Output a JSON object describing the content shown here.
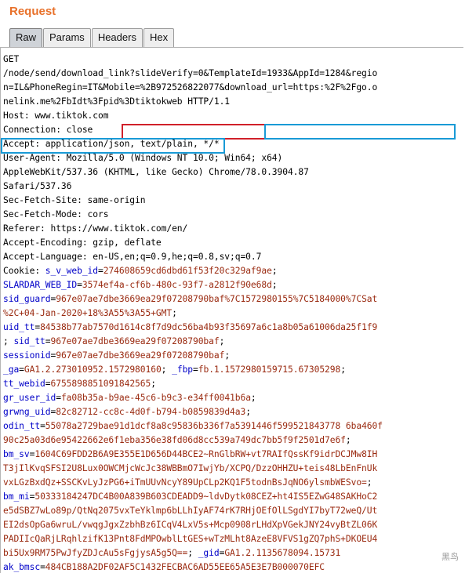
{
  "title": "Request",
  "tabs": [
    "Raw",
    "Params",
    "Headers",
    "Hex"
  ],
  "active_tab": "Raw",
  "lines": [
    [
      {
        "t": "GET",
        "c": "k"
      }
    ],
    [
      {
        "t": "/node/send/download_link?slideVerify=0&TemplateId=1933&AppId=1284&regio",
        "c": "k"
      }
    ],
    [
      {
        "t": "n=IL&PhoneRegin=IT&Mobile=%2B972526822077&download_url=https:%2F%2Fgo.o",
        "c": "k"
      }
    ],
    [
      {
        "t": "nelink.me%2FbIdt%3Fpid%3Dtiktokweb HTTP/1.1",
        "c": "k"
      }
    ],
    [
      {
        "t": "Host: www.tiktok.com",
        "c": "k"
      }
    ],
    [
      {
        "t": "Connection: close",
        "c": "k"
      }
    ],
    [
      {
        "t": "Accept: application/json, text/plain, */*",
        "c": "k"
      }
    ],
    [
      {
        "t": "User-Agent: Mozilla/5.0 (Windows NT 10.0; Win64; x64)",
        "c": "k"
      }
    ],
    [
      {
        "t": "AppleWebKit/537.36 (KHTML, like Gecko) Chrome/78.0.3904.87",
        "c": "k"
      }
    ],
    [
      {
        "t": "Safari/537.36",
        "c": "k"
      }
    ],
    [
      {
        "t": "Sec-Fetch-Site: same-origin",
        "c": "k"
      }
    ],
    [
      {
        "t": "Sec-Fetch-Mode: cors",
        "c": "k"
      }
    ],
    [
      {
        "t": "Referer: https://www.tiktok.com/en/",
        "c": "k"
      }
    ],
    [
      {
        "t": "Accept-Encoding: gzip, deflate",
        "c": "k"
      }
    ],
    [
      {
        "t": "Accept-Language: en-US,en;q=0.9,he;q=0.8,sv;q=0.7",
        "c": "k"
      }
    ],
    [
      {
        "t": "Cookie: ",
        "c": "k"
      },
      {
        "t": "s_v_web_id",
        "c": "u"
      },
      {
        "t": "=",
        "c": "k"
      },
      {
        "t": "274608659cd6dbd61f53f20c329af9ae",
        "c": "v"
      },
      {
        "t": ";",
        "c": "k"
      }
    ],
    [
      {
        "t": "SLARDAR_WEB_ID",
        "c": "u"
      },
      {
        "t": "=",
        "c": "k"
      },
      {
        "t": "3574ef4a-cf6b-480c-93f7-a2812f90e68d",
        "c": "v"
      },
      {
        "t": ";",
        "c": "k"
      }
    ],
    [
      {
        "t": "sid_guard",
        "c": "u"
      },
      {
        "t": "=",
        "c": "k"
      },
      {
        "t": "967e07ae7dbe3669ea29f07208790baf%7C1572980155%7C5184000%7CSat",
        "c": "v"
      }
    ],
    [
      {
        "t": "%2C+04-Jan-2020+18%3A55%3A55+GMT",
        "c": "v"
      },
      {
        "t": ";",
        "c": "k"
      }
    ],
    [
      {
        "t": "uid_tt",
        "c": "u"
      },
      {
        "t": "=",
        "c": "k"
      },
      {
        "t": "84538b77ab7570d1614c8f7d9dc56ba4b93f35697a6c1a8b05a61006da25f1f9",
        "c": "v"
      }
    ],
    [
      {
        "t": "; ",
        "c": "k"
      },
      {
        "t": "sid_tt",
        "c": "u"
      },
      {
        "t": "=",
        "c": "k"
      },
      {
        "t": "967e07ae7dbe3669ea29f07208790baf",
        "c": "v"
      },
      {
        "t": ";",
        "c": "k"
      }
    ],
    [
      {
        "t": "sessionid",
        "c": "u"
      },
      {
        "t": "=",
        "c": "k"
      },
      {
        "t": "967e07ae7dbe3669ea29f07208790baf",
        "c": "v"
      },
      {
        "t": ";",
        "c": "k"
      }
    ],
    [
      {
        "t": "_ga",
        "c": "u"
      },
      {
        "t": "=",
        "c": "k"
      },
      {
        "t": "GA1.2.273010952.1572980160",
        "c": "v"
      },
      {
        "t": "; ",
        "c": "k"
      },
      {
        "t": "_fbp",
        "c": "u"
      },
      {
        "t": "=",
        "c": "k"
      },
      {
        "t": "fb.1.1572980159715.67305298",
        "c": "v"
      },
      {
        "t": ";",
        "c": "k"
      }
    ],
    [
      {
        "t": "tt_webid",
        "c": "u"
      },
      {
        "t": "=",
        "c": "k"
      },
      {
        "t": "6755898851091842565",
        "c": "v"
      },
      {
        "t": ";",
        "c": "k"
      }
    ],
    [
      {
        "t": "gr_user_id",
        "c": "u"
      },
      {
        "t": "=",
        "c": "k"
      },
      {
        "t": "fa08b35a-b9ae-45c6-b9c3-e34ff0041b6a",
        "c": "v"
      },
      {
        "t": ";",
        "c": "k"
      }
    ],
    [
      {
        "t": "grwng_uid",
        "c": "u"
      },
      {
        "t": "=",
        "c": "k"
      },
      {
        "t": "82c82712-cc8c-4d0f-b794-b0859839d4a3",
        "c": "v"
      },
      {
        "t": ";",
        "c": "k"
      }
    ],
    [
      {
        "t": "odin_tt",
        "c": "u"
      },
      {
        "t": "=",
        "c": "k"
      },
      {
        "t": "55078a2729bae91d1dcf8a8c95836b336f7a5391446f599521843778 6ba460f",
        "c": "v"
      }
    ],
    [
      {
        "t": "90c25a03d6e95422662e6f1eba356e38fd06d8cc539a749dc7bb5f9f2501d7e6f",
        "c": "v"
      },
      {
        "t": ";",
        "c": "k"
      }
    ],
    [
      {
        "t": "bm_sv",
        "c": "u"
      },
      {
        "t": "=",
        "c": "k"
      },
      {
        "t": "1604C69FDD2B6A9E355E1D656D44BCE2~RnGlbRW+vt7RAIfQssKf9idrDCJMw8IH",
        "c": "v"
      }
    ],
    [
      {
        "t": "T3jIlKvqSFSI2U8Lux0OWCMjcWcJc38WBBmO7IwjYb/XCPQ/DzzOHHZU+teis48LbEnFnUk",
        "c": "v"
      }
    ],
    [
      {
        "t": "vxLGzBxdQz+SSCKvLyJzPG6+iTmUUvNcyY89UpCLp2KQ1F5todnBsJqNO6ylsmbWESvo=",
        "c": "v"
      },
      {
        "t": ";",
        "c": "k"
      }
    ],
    [
      {
        "t": "bm_mi",
        "c": "u"
      },
      {
        "t": "=",
        "c": "k"
      },
      {
        "t": "50333184247DC4B00A839B603CDEADD9~ldvDytk08CEZ+ht4IS5EZwG48SAKHoC2",
        "c": "v"
      }
    ],
    [
      {
        "t": "e5dSBZ7wLo89p/QtNq2075vxTeYklmp6bLLhIyAF74rK7RHjOEfOlLSgdYI7byT72weQ/Ut",
        "c": "v"
      }
    ],
    [
      {
        "t": "EI2dsOpGa6wruL/vwqgJgxZzbhBz6ICqV4LxV5s+Mcp0908rLHdXpVGekJNY24vyBtZL06K",
        "c": "v"
      }
    ],
    [
      {
        "t": "PADIIcQaRjLRqhlzifK13Pnt8FdMPOwblLtGES+wTzMLht8AzeE8VFVS1gZQ7phS+DKOEU4",
        "c": "v"
      }
    ],
    [
      {
        "t": "bi5Ux9RM75PwJfyZDJcAu5sFgjysA5g5Q==",
        "c": "v"
      },
      {
        "t": "; ",
        "c": "k"
      },
      {
        "t": "_gid",
        "c": "u"
      },
      {
        "t": "=",
        "c": "k"
      },
      {
        "t": "GA1.2.1135678094.15731",
        "c": "v"
      }
    ],
    [
      {
        "t": "ak_bmsc",
        "c": "u"
      },
      {
        "t": "=",
        "c": "k"
      },
      {
        "t": "484CB188A2DF02AF5C1432FECBAC6AD55EE65A5E3E7B000070EFC",
        "c": "v"
      }
    ]
  ],
  "watermark": "黑鸟"
}
